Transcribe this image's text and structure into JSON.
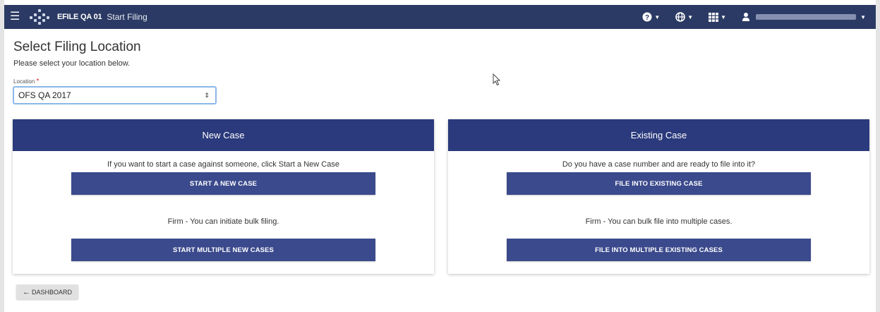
{
  "navbar": {
    "menu_icon": "hamburger-icon",
    "brand": "EFILE QA 01",
    "page": "Start Filing",
    "help_icon": "question-circle-icon",
    "language_icon": "globe-icon",
    "apps_icon": "grid-icon",
    "user_icon": "user-icon"
  },
  "page": {
    "title": "Select Filing Location",
    "subtitle": "Please select your location below.",
    "location_label": "Location",
    "required_mark": "*",
    "location_value": "OFS QA 2017"
  },
  "new_case": {
    "header": "New Case",
    "text1": "If you want to start a case against someone, click Start a New Case",
    "button1": "START A NEW CASE",
    "text2": "Firm - You can initiate bulk filing.",
    "button2": "START MULTIPLE NEW CASES"
  },
  "existing_case": {
    "header": "Existing Case",
    "text1": "Do you have a case number and are ready to file into it?",
    "button1": "FILE INTO EXISTING CASE",
    "text2": "Firm - You can bulk file into multiple cases.",
    "button2": "FILE INTO MULTIPLE EXISTING CASES"
  },
  "footer": {
    "dashboard_arrow": "←",
    "dashboard_label": "DASHBOARD"
  },
  "colors": {
    "navbar": "#2b3a64",
    "card_header": "#2b3a7c",
    "button": "#3b4a8c",
    "required": "#d9262a"
  }
}
